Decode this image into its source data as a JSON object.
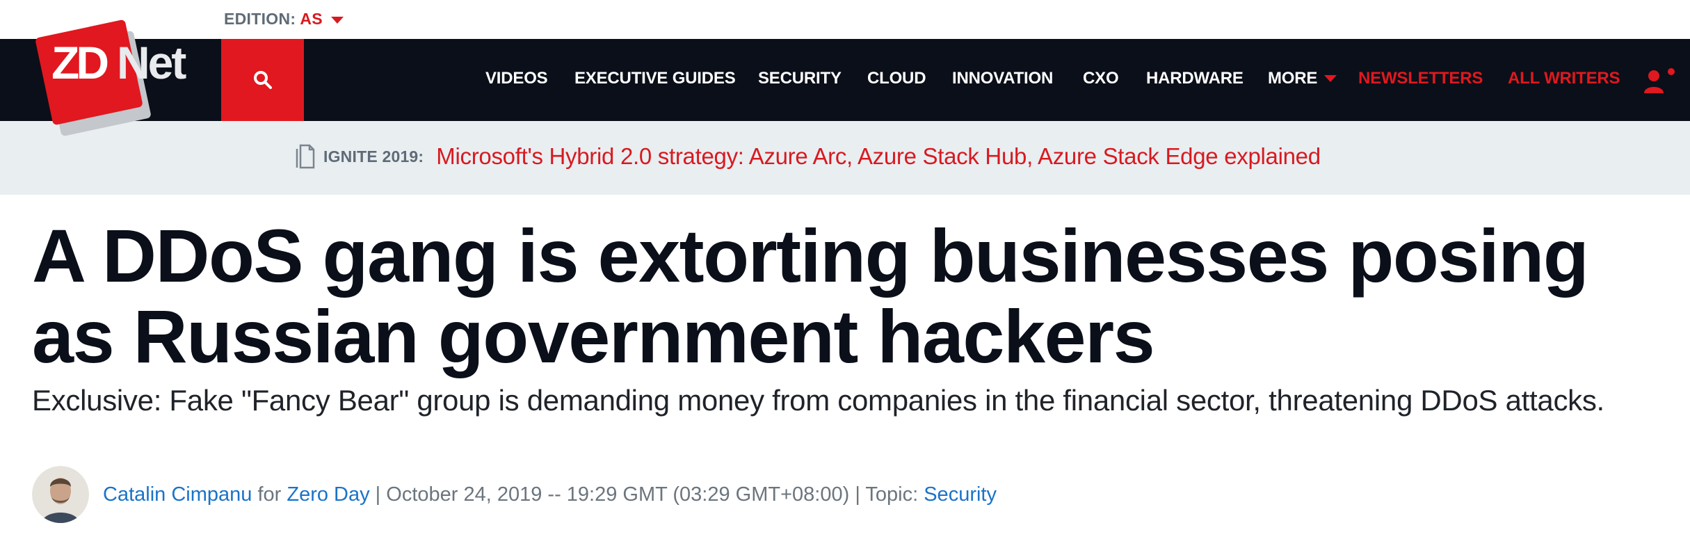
{
  "edition": {
    "label": "EDITION:",
    "value": "AS"
  },
  "logo": {
    "zd": "ZD",
    "net": "Net"
  },
  "nav": [
    {
      "label": "VIDEOS"
    },
    {
      "label": "EXECUTIVE GUIDES"
    },
    {
      "label": "SECURITY"
    },
    {
      "label": "CLOUD"
    },
    {
      "label": "INNOVATION"
    },
    {
      "label": "CXO"
    },
    {
      "label": "HARDWARE"
    },
    {
      "label": "MORE"
    },
    {
      "label": "NEWSLETTERS"
    },
    {
      "label": "ALL WRITERS"
    }
  ],
  "promo": {
    "tag": "IGNITE 2019:",
    "link": "Microsoft's Hybrid 2.0 strategy: Azure Arc, Azure Stack Hub, Azure Stack Edge explained"
  },
  "article": {
    "headline": "A DDoS gang is extorting businesses posing as Russian government hackers",
    "subhead": "Exclusive: Fake \"Fancy Bear\" group is demanding money from companies in the financial sector, threatening DDoS attacks."
  },
  "byline": {
    "author": "Catalin Cimpanu",
    "for": " for ",
    "blog": "Zero Day",
    "date": " | October 24, 2019 -- 19:29 GMT (03:29 GMT+08:00) | Topic: ",
    "topic": "Security"
  },
  "colors": {
    "brand_red": "#e1181f",
    "nav_bg": "#0b0f19",
    "promo_bg": "#e9eef1",
    "link_blue": "#1a73c9"
  },
  "icons": [
    "search-icon",
    "chevron-down-icon",
    "user-icon",
    "document-icon"
  ]
}
